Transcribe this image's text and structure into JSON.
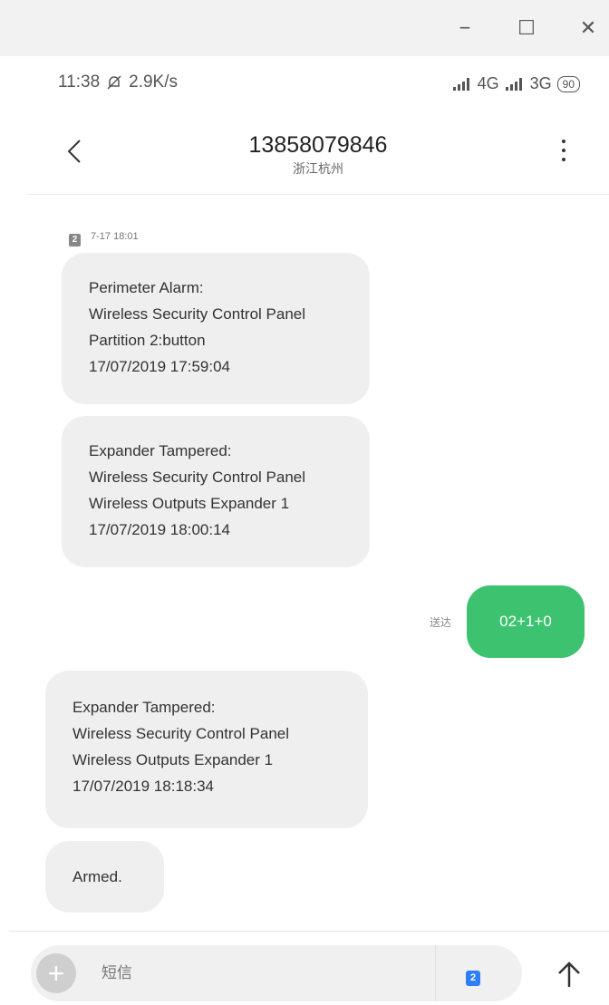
{
  "window": {
    "minimize_icon": "−",
    "maximize_icon": "☐",
    "close_icon": "✕"
  },
  "status_bar": {
    "time": "11:38",
    "speed": "2.9K/s",
    "network_1": "4G",
    "network_2": "3G",
    "battery": "90"
  },
  "header": {
    "number": "13858079846",
    "location": "浙江杭州"
  },
  "conversation": {
    "sim_label": "2",
    "timestamp": "7-17 18:01",
    "messages": [
      {
        "lines": [
          "Perimeter Alarm:",
          "Wireless Security Control Panel",
          "Partition 2:button",
          "17/07/2019 17:59:04"
        ]
      },
      {
        "lines": [
          "Expander Tampered:",
          "Wireless Security Control Panel",
          "Wireless Outputs Expander 1",
          "17/07/2019 18:00:14"
        ]
      },
      {
        "lines": [
          "Expander Tampered:",
          "Wireless Security Control Panel",
          "Wireless Outputs Expander 1",
          "17/07/2019 18:18:34"
        ]
      },
      {
        "lines": [
          "Armed."
        ]
      }
    ],
    "sent": {
      "text": "02+1+0",
      "status": "送达"
    }
  },
  "composer": {
    "placeholder": "短信",
    "sim": "2"
  }
}
